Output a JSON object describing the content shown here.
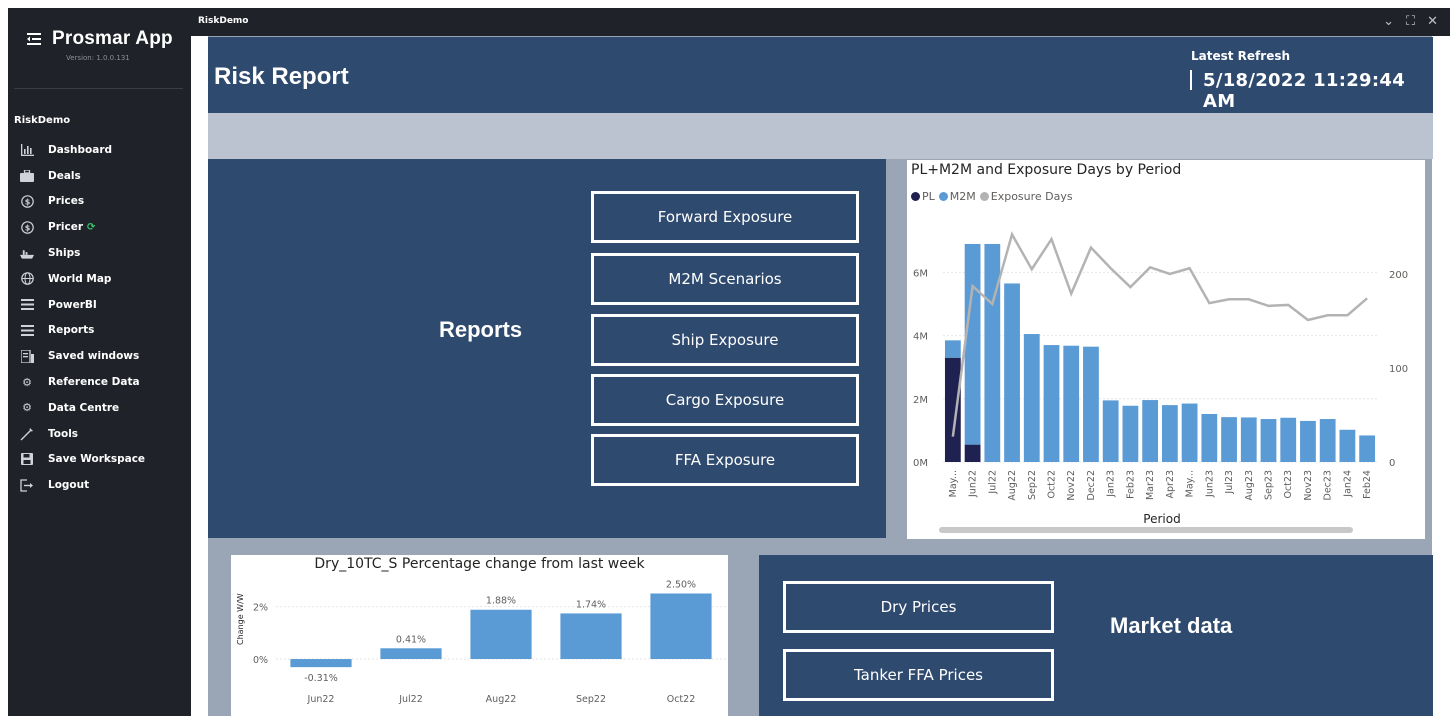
{
  "sidebar": {
    "app_title": "Prosmar App",
    "version": "Version: 1.0.0.131",
    "workspace": "RiskDemo",
    "items": [
      {
        "label": "Dashboard",
        "icon": "bar-chart-icon"
      },
      {
        "label": "Deals",
        "icon": "briefcase-icon"
      },
      {
        "label": "Prices",
        "icon": "dollar-circle-icon"
      },
      {
        "label": "Pricer",
        "icon": "dollar-circle-icon"
      },
      {
        "label": "Ships",
        "icon": "ship-icon"
      },
      {
        "label": "World Map",
        "icon": "globe-icon"
      },
      {
        "label": "PowerBI",
        "icon": "list-icon"
      },
      {
        "label": "Reports",
        "icon": "list-icon"
      },
      {
        "label": "Saved windows",
        "icon": "windows-icon"
      },
      {
        "label": "Reference Data",
        "icon": "gear-icon"
      },
      {
        "label": "Data Centre",
        "icon": "gear-icon"
      },
      {
        "label": "Tools",
        "icon": "tools-icon"
      },
      {
        "label": "Save Workspace",
        "icon": "save-icon"
      },
      {
        "label": "Logout",
        "icon": "logout-icon"
      }
    ]
  },
  "titlebar": {
    "title": "RiskDemo"
  },
  "header": {
    "title": "Risk Report",
    "refresh_label": "Latest Refresh",
    "refresh_value": "5/18/2022 11:29:44 AM"
  },
  "reports": {
    "heading": "Reports",
    "buttons": [
      "Forward Exposure",
      "M2M Scenarios",
      "Ship Exposure",
      "Cargo Exposure",
      "FFA Exposure"
    ]
  },
  "market": {
    "heading": "Market data",
    "buttons": [
      "Dry Prices",
      "Tanker FFA Prices"
    ]
  },
  "colors": {
    "navy": "#2e4a6e",
    "pl": "#1f2150",
    "m2m": "#5b9bd5",
    "exposure": "#b3b3b3"
  },
  "chart_data": [
    {
      "type": "bar",
      "title": "PL+M2M and Exposure Days by Period",
      "xlabel": "Period",
      "legend": [
        "PL",
        "M2M",
        "Exposure Days"
      ],
      "categories": [
        "May...",
        "Jun22",
        "Jul22",
        "Aug22",
        "Sep22",
        "Oct22",
        "Nov22",
        "Dec22",
        "Jan23",
        "Feb23",
        "Mar23",
        "Apr23",
        "May...",
        "Jun23",
        "Jul23",
        "Aug23",
        "Sep23",
        "Oct23",
        "Nov23",
        "Dec23",
        "Jan24",
        "Feb24"
      ],
      "y_ticks": [
        "0M",
        "2M",
        "4M",
        "6M"
      ],
      "y2_ticks": [
        "0",
        "100",
        "200"
      ],
      "ylim": [
        0,
        7.5
      ],
      "y2lim": [
        0,
        252
      ],
      "series": [
        {
          "name": "PL",
          "values": [
            3.3,
            0.55,
            0,
            0,
            0,
            0,
            0,
            0,
            0,
            0,
            0,
            0,
            0,
            0,
            0,
            0,
            0,
            0,
            0,
            0,
            0,
            0
          ]
        },
        {
          "name": "M2M",
          "values": [
            0.55,
            6.35,
            6.9,
            5.65,
            4.05,
            3.7,
            3.68,
            3.65,
            1.95,
            1.78,
            1.96,
            1.8,
            1.85,
            1.52,
            1.42,
            1.41,
            1.36,
            1.4,
            1.3,
            1.36,
            1.02,
            0.84
          ]
        },
        {
          "name": "Exposure Days",
          "values": [
            27,
            187,
            168,
            242,
            205,
            237,
            179,
            228,
            206,
            186,
            207,
            200,
            206,
            169,
            173,
            173,
            166,
            167,
            151,
            156,
            156,
            174
          ]
        }
      ]
    },
    {
      "type": "bar",
      "title": "Dry_10TC_S Percentage change from last week",
      "ylabel": "Change W/W",
      "categories": [
        "Jun22",
        "Jul22",
        "Aug22",
        "Sep22",
        "Oct22"
      ],
      "values": [
        -0.31,
        0.41,
        1.88,
        1.74,
        2.5
      ],
      "value_labels": [
        "-0.31%",
        "0.41%",
        "1.88%",
        "1.74%",
        "2.50%"
      ],
      "y_ticks": [
        "0%",
        "2%"
      ],
      "ylim": [
        -0.8,
        2.9
      ]
    }
  ]
}
